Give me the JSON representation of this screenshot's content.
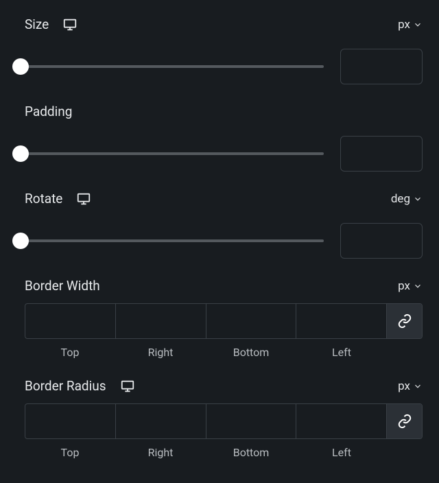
{
  "size": {
    "label": "Size",
    "unit": "px",
    "value": ""
  },
  "padding": {
    "label": "Padding",
    "value": ""
  },
  "rotate": {
    "label": "Rotate",
    "unit": "deg",
    "value": ""
  },
  "borderWidth": {
    "label": "Border Width",
    "unit": "px",
    "sides": {
      "top": "Top",
      "right": "Right",
      "bottom": "Bottom",
      "left": "Left"
    },
    "values": {
      "top": "",
      "right": "",
      "bottom": "",
      "left": ""
    }
  },
  "borderRadius": {
    "label": "Border Radius",
    "unit": "px",
    "sides": {
      "top": "Top",
      "right": "Right",
      "bottom": "Bottom",
      "left": "Left"
    },
    "values": {
      "top": "",
      "right": "",
      "bottom": "",
      "left": ""
    }
  }
}
